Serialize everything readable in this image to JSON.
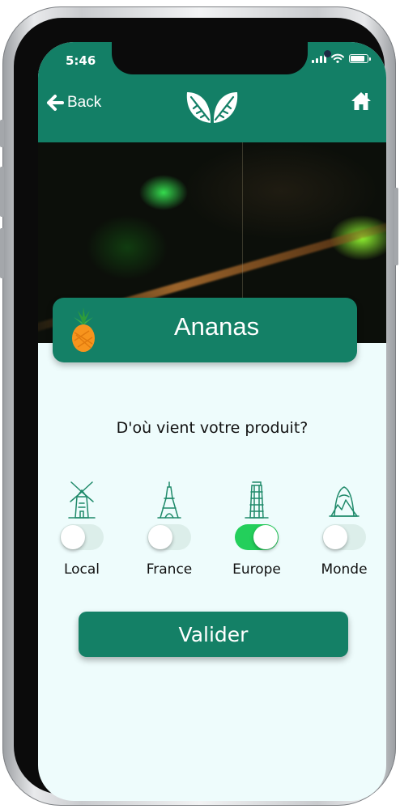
{
  "status_bar": {
    "time": "5:46"
  },
  "header": {
    "back_label": "Back",
    "logo_icon": "leaves-icon",
    "home_icon": "home-icon"
  },
  "product": {
    "name": "Ananas",
    "icon": "pineapple-icon"
  },
  "question": "D'où vient votre produit?",
  "origins": [
    {
      "label": "Local",
      "icon": "windmill-icon",
      "selected": false
    },
    {
      "label": "France",
      "icon": "eiffel-tower-icon",
      "selected": false
    },
    {
      "label": "Europe",
      "icon": "leaning-tower-icon",
      "selected": true
    },
    {
      "label": "Monde",
      "icon": "world-landmark-icon",
      "selected": false
    }
  ],
  "validate_label": "Valider",
  "colors": {
    "primary": "#148066",
    "toggle_on": "#23cf5b",
    "background": "#eefcfc"
  }
}
